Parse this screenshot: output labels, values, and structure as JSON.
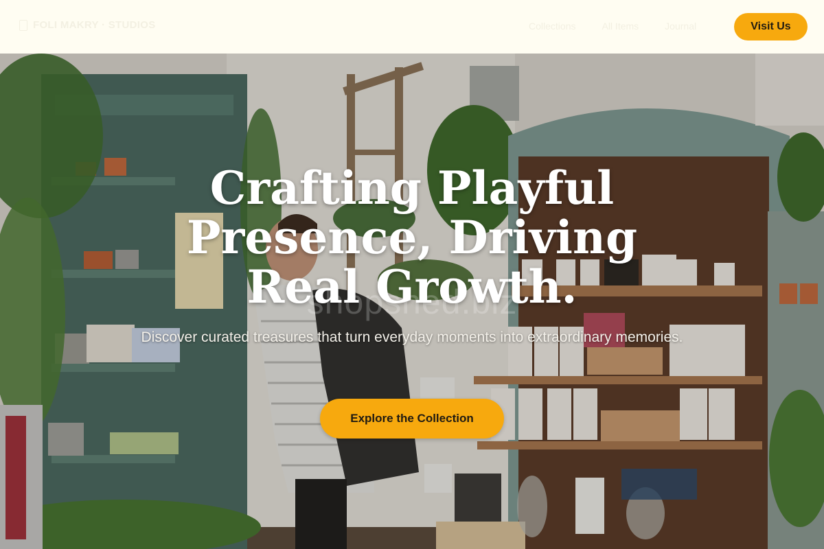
{
  "header": {
    "logo_text": "FOLI MAKRY · STUDIOS",
    "nav": [
      {
        "label": "Collections"
      },
      {
        "label": "All Items"
      },
      {
        "label": "Journal"
      }
    ],
    "visit_label": "Visit Us",
    "accent_color": "#f7a90e"
  },
  "hero": {
    "title": "Crafting Playful Presence, Driving Real Growth.",
    "watermark": "shopshed.biz",
    "subtitle": "Discover curated treasures that turn everyday moments into extraordinary memories.",
    "cta_label": "Explore the Collection"
  }
}
